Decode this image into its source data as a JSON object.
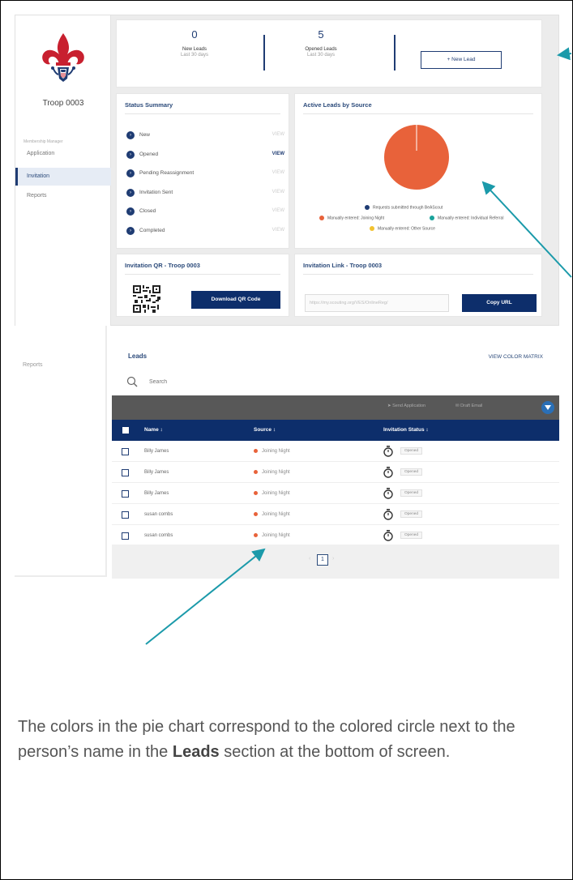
{
  "troop_name": "Troop 0003",
  "sidebar": {
    "member_label": "Membership Manager",
    "items": [
      {
        "label": "Application"
      },
      {
        "label": "Invitation"
      },
      {
        "label": "Reports"
      }
    ],
    "lower_item": "Reports"
  },
  "stats": {
    "new_leads": {
      "value": "0",
      "label": "New Leads",
      "sub": "Last 30 days"
    },
    "opened_leads": {
      "value": "5",
      "label": "Opened Leads",
      "sub": "Last 30 days"
    },
    "new_lead_button": "+ New Lead"
  },
  "status_summary": {
    "title": "Status Summary",
    "rows": [
      {
        "label": "New",
        "view": "VIEW",
        "active": false
      },
      {
        "label": "Opened",
        "view": "VIEW",
        "active": true
      },
      {
        "label": "Pending Reassignment",
        "view": "VIEW",
        "active": false
      },
      {
        "label": "Invitation Sent",
        "view": "VIEW",
        "active": false
      },
      {
        "label": "Closed",
        "view": "VIEW",
        "active": false
      },
      {
        "label": "Completed",
        "view": "VIEW",
        "active": false
      }
    ]
  },
  "chart_data": {
    "type": "pie",
    "title": "Active Leads by Source",
    "series": [
      {
        "name": "Requests submitted through BeAScout",
        "value": 0,
        "color": "#1f3c73"
      },
      {
        "name": "Manually entered: Joining Night",
        "value": 5,
        "color": "#e8623a"
      },
      {
        "name": "Manually entered: Individual Referral",
        "value": 0,
        "color": "#1aa39b"
      },
      {
        "name": "Manually entered: Other Source",
        "value": 0,
        "color": "#f2c230"
      }
    ],
    "legend": "bottom"
  },
  "invitation_qr": {
    "title": "Invitation QR - Troop 0003",
    "button": "Download QR Code"
  },
  "invitation_link": {
    "title": "Invitation Link - Troop 0003",
    "url": "https://my.scouting.org/VES/OnlineReg/",
    "button": "Copy URL"
  },
  "leads": {
    "title": "Leads",
    "color_matrix": "VIEW COLOR MATRIX",
    "search_placeholder": "Search",
    "toolbar": {
      "send_application": "Send Application",
      "draft_email": "Draft Email"
    },
    "columns": [
      "Name ↕",
      "Source ↕",
      "Invitation Status ↕"
    ],
    "rows": [
      {
        "name": "Billy James",
        "source": "Joining Night",
        "status": "Opened"
      },
      {
        "name": "Billy James",
        "source": "Joining Night",
        "status": "Opened"
      },
      {
        "name": "Billy James",
        "source": "Joining Night",
        "status": "Opened"
      },
      {
        "name": "susan combs",
        "source": "Joining Night",
        "status": "Opened"
      },
      {
        "name": "susan combs",
        "source": "Joining Night",
        "status": "Opened"
      }
    ],
    "page": "1"
  },
  "caption": {
    "text_before": "The colors in the pie chart correspond to the colored circle next to the person’s name in the ",
    "bold": "Leads",
    "text_after": " section at the bottom of screen."
  },
  "colors": {
    "navy": "#0d2e6b",
    "accent_orange": "#e8623a",
    "callout_teal": "#1b9aaa"
  }
}
